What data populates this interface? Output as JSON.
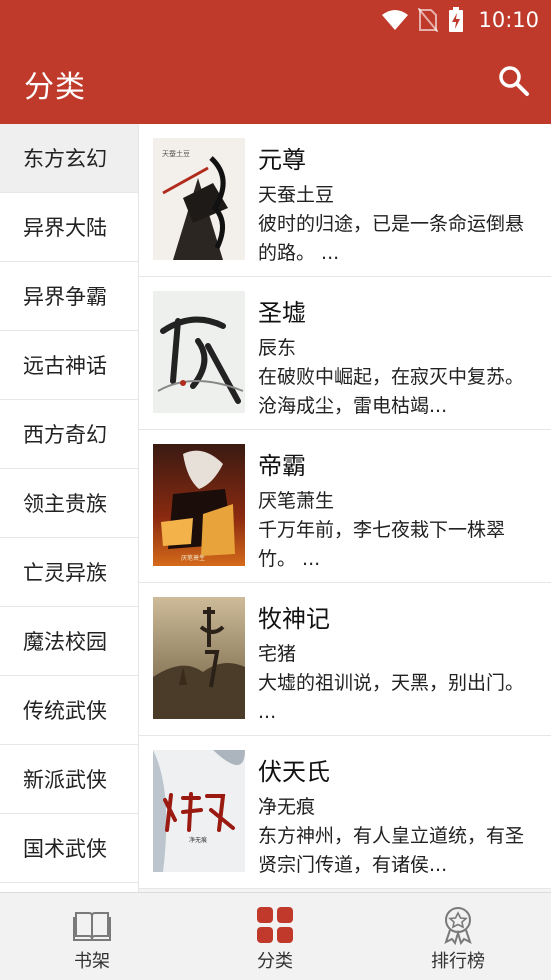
{
  "status": {
    "time": "10:10"
  },
  "header": {
    "title": "分类"
  },
  "categories": [
    "东方玄幻",
    "异界大陆",
    "异界争霸",
    "远古神话",
    "西方奇幻",
    "领主贵族",
    "亡灵异族",
    "魔法校园",
    "传统武侠",
    "新派武侠",
    "国术武侠"
  ],
  "books": [
    {
      "title": "元尊",
      "author": "天蚕土豆",
      "desc": "彼时的归途，已是一条命运倒悬的路。 ...",
      "cover_text": "天蚕土豆"
    },
    {
      "title": "圣墟",
      "author": "辰东",
      "desc": "在破败中崛起，在寂灭中复苏。沧海成尘，雷电枯竭..."
    },
    {
      "title": "帝霸",
      "author": "厌笔萧生",
      "desc": "千万年前，李七夜栽下一株翠竹。 ...",
      "cover_text": "厌笔萧生"
    },
    {
      "title": "牧神记",
      "author": "宅猪",
      "desc": "大墟的祖训说，天黑，别出门。 ..."
    },
    {
      "title": "伏天氏",
      "author": "净无痕",
      "desc": "东方神州，有人皇立道统，有圣贤宗门传道，有诸侯...",
      "cover_text": "净无痕"
    }
  ],
  "nav": {
    "shelf": "书架",
    "category": "分类",
    "ranking": "排行榜"
  },
  "colors": {
    "primary": "#bf3a2b",
    "active_nav": "#c0392b"
  }
}
